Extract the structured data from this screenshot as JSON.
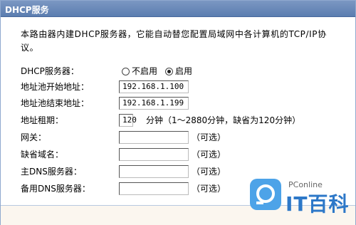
{
  "window": {
    "title": "DHCP服务"
  },
  "description": "本路由器内建DHCP服务器，它能自动替您配置局域网中各计算机的TCP/IP协议。",
  "dhcp_server": {
    "label": "DHCP服务器：",
    "option_disable": "不启用",
    "option_enable": "启用",
    "selected": "启用"
  },
  "fields": {
    "pool_start": {
      "label": "地址池开始地址：",
      "value": "192.168.1.100"
    },
    "pool_end": {
      "label": "地址池结束地址：",
      "value": "192.168.1.199"
    },
    "lease": {
      "label": "地址租期：",
      "value": "120",
      "hint": "分钟（1～2880分钟，缺省为120分钟）"
    },
    "gateway": {
      "label": "网关：",
      "value": "",
      "hint": "（可选）"
    },
    "domain": {
      "label": "缺省域名：",
      "value": "",
      "hint": "（可选）"
    },
    "dns_primary": {
      "label": "主DNS服务器：",
      "value": "",
      "hint": "（可选）"
    },
    "dns_backup": {
      "label": "备用DNS服务器：",
      "value": "",
      "hint": "（可选）"
    }
  },
  "watermark": {
    "small": "PConline",
    "big": "IT百科"
  }
}
